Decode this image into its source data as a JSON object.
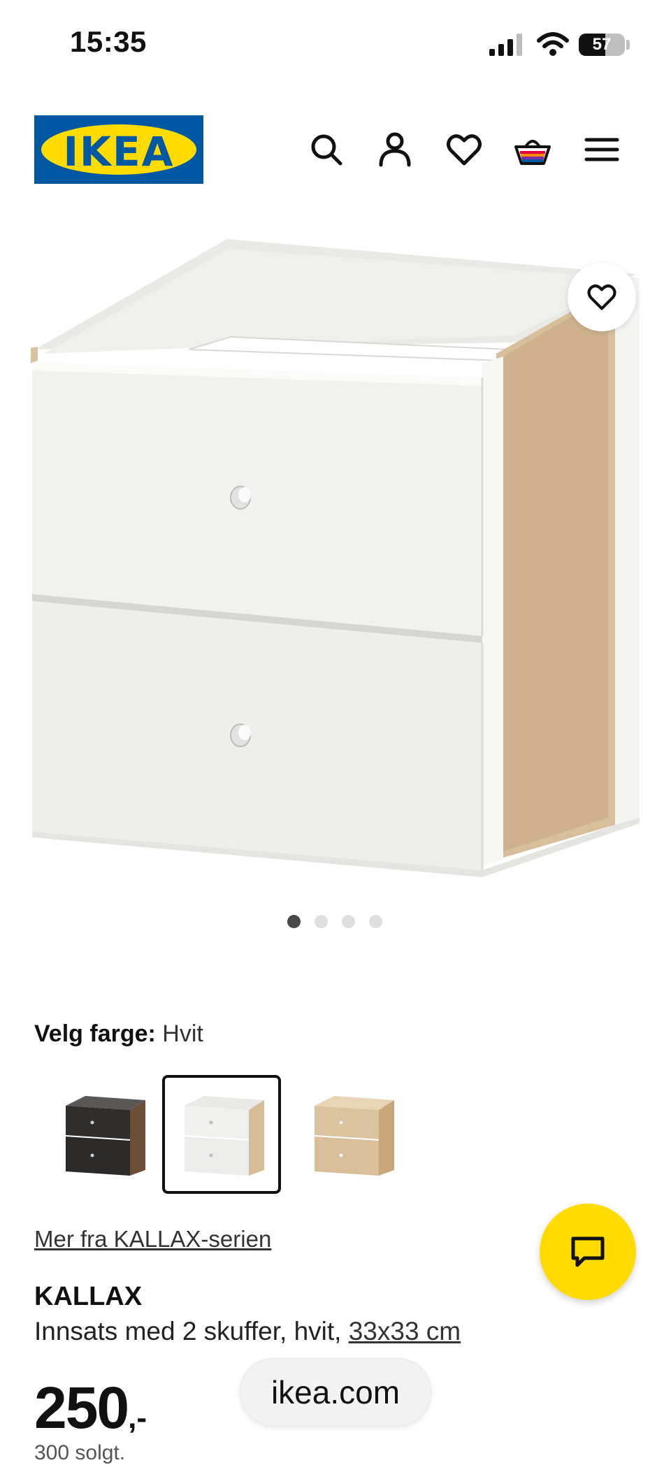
{
  "status_bar": {
    "time": "15:35",
    "battery": "57"
  },
  "header": {
    "logo_text": "IKEA",
    "icons": [
      "search-icon",
      "user-icon",
      "heart-icon",
      "shopping-basket-icon",
      "menu-icon"
    ]
  },
  "gallery": {
    "image_count": 4,
    "active_index": 0
  },
  "color_selector": {
    "label": "Velg farge:",
    "value": "Hvit",
    "options": [
      "black-brown",
      "white",
      "white-stained-oak"
    ],
    "selected_index": 1
  },
  "series_link": "Mer fra KALLAX-serien",
  "product": {
    "name": "KALLAX",
    "description": "Innsats med 2 skuffer, hvit, ",
    "size": "33x33 cm",
    "price_int": "250",
    "price_dec": ",-",
    "cut_off_text": "300 solgt."
  },
  "browser": {
    "url": "ikea.com"
  },
  "colors": {
    "ikea_blue": "#0058a3",
    "ikea_yellow": "#ffdb00"
  }
}
